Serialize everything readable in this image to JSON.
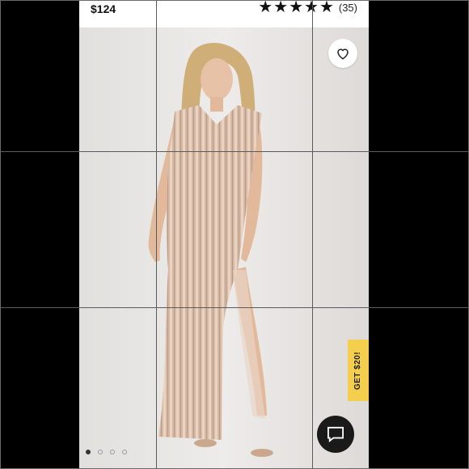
{
  "product": {
    "price": "$124",
    "rating_stars": 5,
    "review_count": "(35)"
  },
  "actions": {
    "favorite_icon": "heart-icon",
    "promo_label": "GET $20!",
    "chat_icon": "chat-icon"
  },
  "carousel": {
    "pages": 4,
    "active_index": 0
  },
  "colors": {
    "promo_bg": "#f4cf4d",
    "dress": "#d9bba6",
    "chat_bg": "#1a1a1a"
  }
}
